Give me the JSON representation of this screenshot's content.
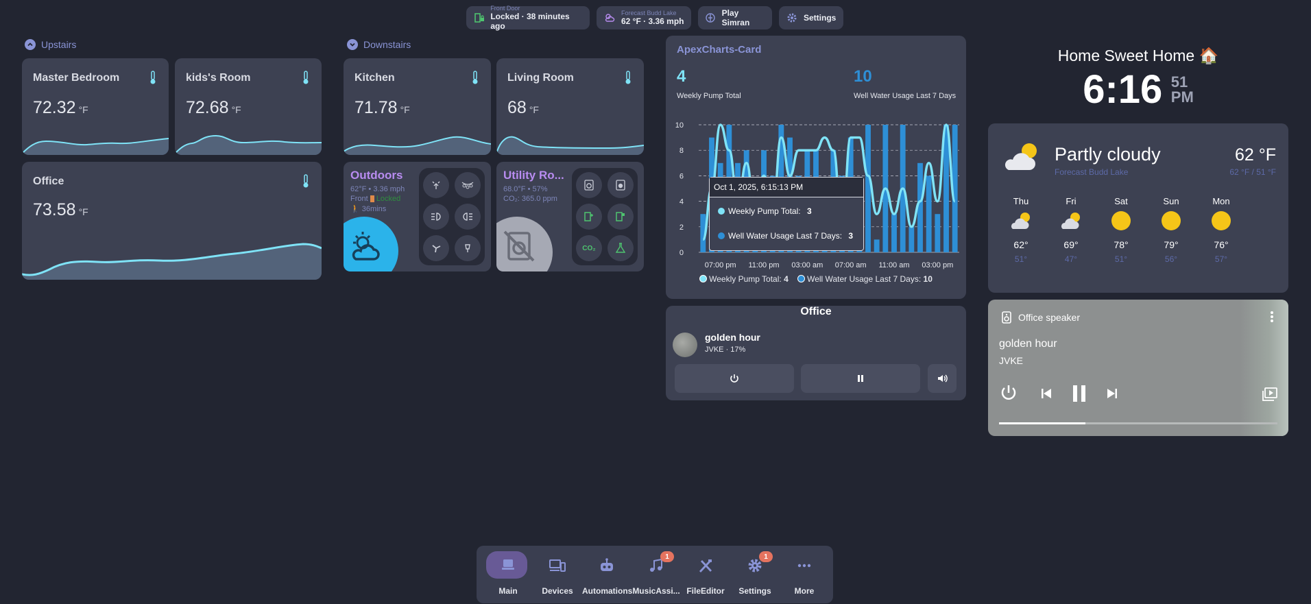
{
  "chips": {
    "front_door": {
      "label": "Front Door",
      "value": "Locked · 38 minutes ago"
    },
    "forecast": {
      "label": "Forecast Budd Lake",
      "value": "62 °F · 3.36 mph"
    },
    "play": {
      "label": "Play Simran"
    },
    "settings": {
      "label": "Settings"
    }
  },
  "upstairs": {
    "heading": "Upstairs",
    "master": {
      "name": "Master Bedroom",
      "value": "72.32",
      "unit": "°F"
    },
    "kids": {
      "name": "kids's Room",
      "value": "72.68",
      "unit": "°F"
    },
    "office": {
      "name": "Office",
      "value": "73.58",
      "unit": "°F"
    }
  },
  "downstairs": {
    "heading": "Downstairs",
    "kitchen": {
      "name": "Kitchen",
      "value": "71.78",
      "unit": "°F"
    },
    "living": {
      "name": "Living Room",
      "value": "68",
      "unit": "°F"
    },
    "outdoors": {
      "title": "Outdoors",
      "line1": "62°F • 3.36 mph",
      "line2_prefix": "Front",
      "line2_status": "Locked",
      "line3": "36mins"
    },
    "utility": {
      "title": "Utility Ro...",
      "line1": "68.0°F • 57%",
      "line2": "CO₂: 365.0 ppm",
      "co2_btn": "CO₂"
    }
  },
  "apex": {
    "title": "ApexCharts-Card",
    "stat1_value": "4",
    "stat1_label": "Weekly Pump Total",
    "stat2_value": "10",
    "stat2_label": "Well Water Usage Last 7 Days",
    "tooltip_title": "Oct 1, 2025, 6:15:13 PM",
    "tooltip_row1_label": "Weekly Pump Total:",
    "tooltip_row1_value": "3",
    "tooltip_row2_label": "Well Water Usage Last 7 Days:",
    "tooltip_row2_value": "3",
    "legend1_label": "Weekly Pump Total:",
    "legend1_value": "4",
    "legend2_label": "Well Water Usage Last 7 Days:",
    "legend2_value": "10",
    "colors": {
      "line": "#7fe3f7",
      "bars": "#2e8fd6"
    }
  },
  "chart_data": {
    "type": "bar",
    "title": "ApexCharts-Card",
    "y_ticks": [
      "0",
      "2",
      "4",
      "6",
      "8",
      "10"
    ],
    "x_ticks": [
      "07:00 pm",
      "11:00 pm",
      "03:00 am",
      "07:00 am",
      "11:00 am",
      "03:00 pm"
    ],
    "ylim": [
      0,
      10
    ],
    "grid": true,
    "legend": "bottom",
    "series": [
      {
        "name": "Well Water Usage Last 7 Days",
        "kind": "bar",
        "values": [
          3,
          9,
          7,
          10,
          7,
          8,
          3,
          8,
          6,
          10,
          9,
          6,
          8,
          8,
          4,
          8,
          6,
          9,
          2,
          10,
          1,
          10,
          3,
          10,
          2,
          7,
          6,
          3,
          10,
          10
        ]
      },
      {
        "name": "Weekly Pump Total",
        "kind": "line",
        "values": [
          1,
          5,
          10,
          8,
          4,
          7,
          3,
          6,
          3,
          9,
          6,
          8,
          8,
          8,
          9,
          8,
          2,
          9,
          9,
          6,
          3,
          5,
          3,
          5,
          2,
          4,
          7,
          4,
          10,
          4
        ]
      }
    ]
  },
  "clock": {
    "title": "Home Sweet Home 🏠",
    "time": "6:16",
    "seconds": "51",
    "ampm": "PM"
  },
  "weather": {
    "condition": "Partly cloudy",
    "location": "Forecast Budd Lake",
    "temp": "62 °F",
    "range": "62 °F / 51 °F",
    "days": [
      {
        "name": "Thu",
        "icon": "partly-cloudy-icon",
        "high": "62°",
        "low": "51°"
      },
      {
        "name": "Fri",
        "icon": "partly-cloudy-icon",
        "high": "69°",
        "low": "47°"
      },
      {
        "name": "Sat",
        "icon": "sunny-icon",
        "high": "78°",
        "low": "51°"
      },
      {
        "name": "Sun",
        "icon": "sunny-icon",
        "high": "79°",
        "low": "56°"
      },
      {
        "name": "Mon",
        "icon": "sunny-icon",
        "high": "76°",
        "low": "57°"
      }
    ]
  },
  "office_player": {
    "title": "Office",
    "track": "golden hour",
    "artist_volume": "JVKE · 17%"
  },
  "speaker": {
    "name": "Office speaker",
    "track": "golden hour",
    "artist": "JVKE",
    "progress": 0.31
  },
  "nav": [
    {
      "label": "Main",
      "icon": "monitor-icon",
      "badge": ""
    },
    {
      "label": "Devices",
      "icon": "devices-icon",
      "badge": ""
    },
    {
      "label": "Automations",
      "icon": "robot-icon",
      "badge": ""
    },
    {
      "label": "MusicAssi...",
      "icon": "music-icon",
      "badge": "1"
    },
    {
      "label": "FileEditor",
      "icon": "tools-icon",
      "badge": ""
    },
    {
      "label": "Settings",
      "icon": "cog-icon",
      "badge": "1"
    },
    {
      "label": "More",
      "icon": "dots-icon",
      "badge": ""
    }
  ]
}
